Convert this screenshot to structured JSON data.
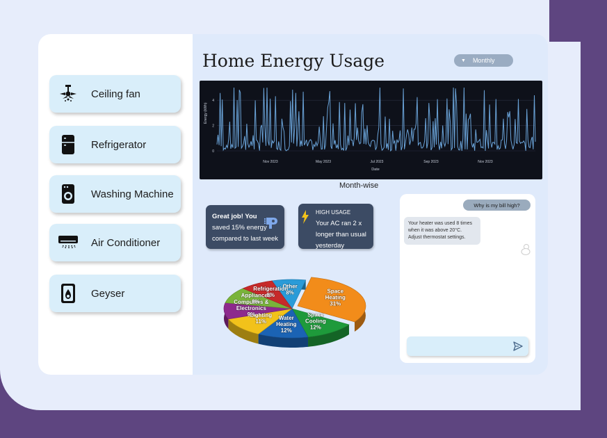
{
  "sidebar": {
    "items": [
      {
        "label": "Ceiling fan",
        "icon": "ceiling-fan-icon"
      },
      {
        "label": "Refrigerator",
        "icon": "refrigerator-icon"
      },
      {
        "label": "Washing Machine",
        "icon": "washing-machine-icon"
      },
      {
        "label": "Air Conditioner",
        "icon": "air-conditioner-icon"
      },
      {
        "label": "Geyser",
        "icon": "geyser-icon"
      }
    ]
  },
  "header": {
    "title": "Home Energy Usage",
    "period_select": "Monthly"
  },
  "line_chart": {
    "ylabel": "Energy (kWh)",
    "xlabel": "Date",
    "y_ticks": [
      "0",
      "2",
      "4"
    ],
    "x_ticks": [
      "Nov 2023",
      "May 2023",
      "Jul 2023",
      "Sep 2023",
      "Nov 2023"
    ],
    "caption": "Month-wise",
    "line_color": "#6aa3d8",
    "background": "#0e111a"
  },
  "tips": {
    "great_job": {
      "bold": "Great job! You",
      "rest": [
        "saved 15% energy",
        "compared to last week"
      ]
    },
    "high_usage": {
      "heading": "HIGH USAGE",
      "lines": [
        "Your AC ran 2 x",
        "longer than usual",
        "yesterday"
      ]
    }
  },
  "chat": {
    "user_message": "Why is my bill high?",
    "bot_message": [
      "Your heater was used 8 times",
      "when it was above 20°C.",
      "Adjust thermostat settings."
    ]
  },
  "chart_data": {
    "type": "pie",
    "slices": [
      {
        "name": "Space Heating",
        "value": 31,
        "color": "#f28c1a"
      },
      {
        "name": "Space Cooling",
        "value": 12,
        "color": "#1e9a3b"
      },
      {
        "name": "Water Heating",
        "value": 12,
        "color": "#1b63b4"
      },
      {
        "name": "Lighting",
        "value": 11,
        "color": "#f2c21a"
      },
      {
        "name": "Computers & Electronics",
        "value": 9,
        "color": "#8d2a8c"
      },
      {
        "name": "Appliances",
        "value": 9,
        "color": "#79b43a"
      },
      {
        "name": "Refrigeration",
        "value": 8,
        "color": "#c62a2a"
      },
      {
        "name": "Other",
        "value": 8,
        "color": "#2a9bd8"
      }
    ],
    "labels": [
      [
        "Space",
        "Heating",
        "31%"
      ],
      [
        "Space",
        "Cooling",
        "12%"
      ],
      [
        "Water",
        "Heating",
        "12%"
      ],
      [
        "Lighting",
        "11%"
      ],
      [
        "Computers &",
        "Electronics",
        "9%"
      ],
      [
        "Appliances",
        "9%"
      ],
      [
        "Refrigeration",
        "8%"
      ],
      [
        "Other",
        "8%"
      ]
    ]
  }
}
